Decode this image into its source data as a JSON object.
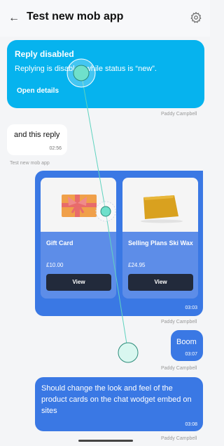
{
  "header": {
    "title": "Test new mob app"
  },
  "notice": {
    "title": "Reply disabled",
    "text": "Replying is disabled while status is “new”.",
    "link": "Open details",
    "sender": "Paddy Campbell"
  },
  "messages": [
    {
      "text": "and this reply",
      "time": "02:56",
      "sender": "Test new mob app"
    }
  ],
  "carousel": {
    "cards": [
      {
        "title": "Gift Card",
        "price": "£10.00",
        "button": "View",
        "image": "gift-card-icon"
      },
      {
        "title": "Selling Plans Ski Wax",
        "price": "£24.95",
        "button": "View",
        "image": "ski-wax-icon"
      }
    ],
    "time": "03:03",
    "sender": "Paddy Campbell"
  },
  "outgoing": [
    {
      "text": "Boom",
      "time": "03:07",
      "sender": "Paddy Campbell"
    },
    {
      "text": "Should change the look and feel of the product cards on the chat wodget embed on sites",
      "time": "03:08",
      "sender": "Paddy Campbell"
    }
  ],
  "colors": {
    "accent": "#3a78e4",
    "notice": "#06b3ee",
    "button": "#222a3b",
    "touch": "#5fd3bf"
  }
}
